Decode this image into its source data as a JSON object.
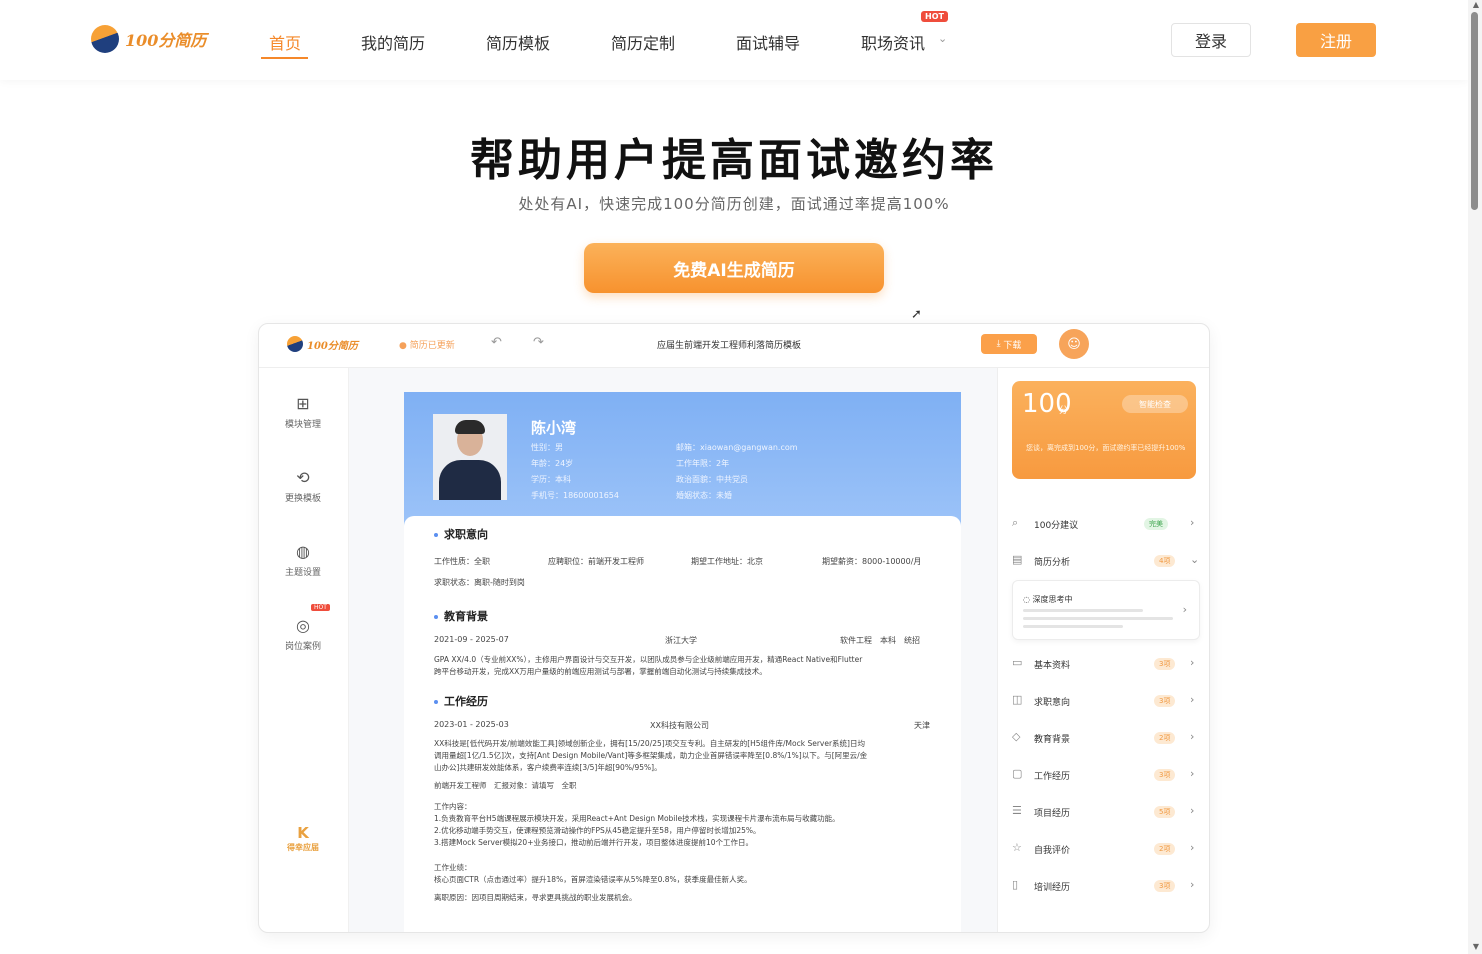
{
  "nav": {
    "logo_text": "100分简历",
    "items": [
      {
        "label": "首页",
        "active": true
      },
      {
        "label": "我的简历"
      },
      {
        "label": "简历模板"
      },
      {
        "label": "简历定制"
      },
      {
        "label": "面试辅导"
      },
      {
        "label": "职场资讯"
      }
    ],
    "hot_badge": "HOT",
    "login": "登录",
    "register": "注册"
  },
  "hero": {
    "title": "帮助用户提高面试邀约率",
    "subtitle": "处处有AI，快速完成100分简历创建，面试通过率提高100%",
    "cta": "免费AI生成简历"
  },
  "editor": {
    "logo_text": "100分简历",
    "saved": "简历已更新",
    "doc_title": "应届生前端开发工程师利落简历模板",
    "download": "下载",
    "sidebar": [
      {
        "label": "模块管理",
        "icon": "grid-icon"
      },
      {
        "label": "更换模板",
        "icon": "swap-icon"
      },
      {
        "label": "主题设置",
        "icon": "palette-icon"
      },
      {
        "label": "岗位案例",
        "icon": "case-icon",
        "badge": "HOT"
      }
    ],
    "brand_bottom": {
      "mark": "K",
      "text": "得幸应届"
    },
    "resume": {
      "name": "陈小湾",
      "left_fields": [
        "性别：男",
        "年龄：24岁",
        "学历：本科",
        "手机号：18600001654"
      ],
      "right_fields": [
        "邮箱：xiaowan@gangwan.com",
        "工作年限：2年",
        "政治面貌：中共党员",
        "婚姻状态：未婚"
      ],
      "intent_title": "求职意向",
      "intent_row1": [
        "工作性质：全职",
        "应聘职位：前端开发工程师",
        "期望工作地址：北京",
        "期望薪资：8000-10000/月"
      ],
      "intent_row2": "求职状态：离职-随时到岗",
      "edu_title": "教育背景",
      "edu_period": "2021-09 - 2025-07",
      "edu_school": "浙江大学",
      "edu_major": "软件工程　本科　统招",
      "edu_desc1": "GPA XX/4.0（专业前XX%），主修用户界面设计与交互开发，以团队成员参与企业级前端应用开发，精通React Native和Flutter",
      "edu_desc2": "跨平台移动开发，完成XX万用户量级的前端应用测试与部署，掌握前端自动化测试与持续集成技术。",
      "work_title": "工作经历",
      "work_period": "2023-01 - 2025-03",
      "work_company": "XX科技有限公司",
      "work_city": "天津",
      "work_desc1": "XX科技是[低代码开发/前端效能工具]领域创新企业，拥有[15/20/25]项交互专利。自主研发的[H5组件库/Mock Server系统]日均",
      "work_desc2": "调用量超[1亿/1.5亿]次，支持[Ant Design Mobile/Vant]等多框架集成，助力企业首屏错误率降至[0.8%/1%]以下。与[阿里云/金",
      "work_desc3": "山办公]共建研发效能体系，客户续费率连续[3/5]年超[90%/95%]。",
      "work_meta": "前端开发工程师　汇报对象：请填写　全职",
      "work_content_title": "工作内容：",
      "work_item1": "1.负责教育平台H5端课程展示模块开发，采用React+Ant Design Mobile技术栈，实现课程卡片瀑布流布局与收藏功能。",
      "work_item2": "2.优化移动端手势交互，使课程预览滑动操作的FPS从45稳定提升至58，用户停留时长增加25%。",
      "work_item3": "3.搭建Mock Server模拟20+业务接口，推动前后端并行开发，项目整体进度提前10个工作日。",
      "work_perf_title": "工作业绩：",
      "work_perf": "核心页面CTR（点击通过率）提升18%，首屏渲染错误率从5%降至0.8%，获季度最佳新人奖。",
      "work_leave": "离职原因：因项目周期结束，寻求更具挑战的职业发展机会。"
    },
    "score": {
      "value": "100",
      "unit": "分",
      "button": "智能检查",
      "desc": "您谈，离完成到100分，面试邀约率已经提升100%"
    },
    "panel": [
      {
        "label": "100分建议",
        "badge": "完美",
        "icon": "search-icon"
      },
      {
        "label": "简历分析",
        "badge": "4项",
        "icon": "chart-icon"
      },
      {
        "label": "基本资料",
        "badge": "3项",
        "icon": "card-icon"
      },
      {
        "label": "求职意向",
        "badge": "3项",
        "icon": "bag-icon"
      },
      {
        "label": "教育背景",
        "badge": "2项",
        "icon": "cap-icon"
      },
      {
        "label": "工作经历",
        "badge": "3项",
        "icon": "monitor-icon"
      },
      {
        "label": "项目经历",
        "badge": "5项",
        "icon": "list-icon"
      },
      {
        "label": "自我评价",
        "badge": "2项",
        "icon": "star-icon"
      },
      {
        "label": "培训经历",
        "badge": "3项",
        "icon": "book-icon"
      }
    ],
    "thinking": "深度思考中"
  }
}
